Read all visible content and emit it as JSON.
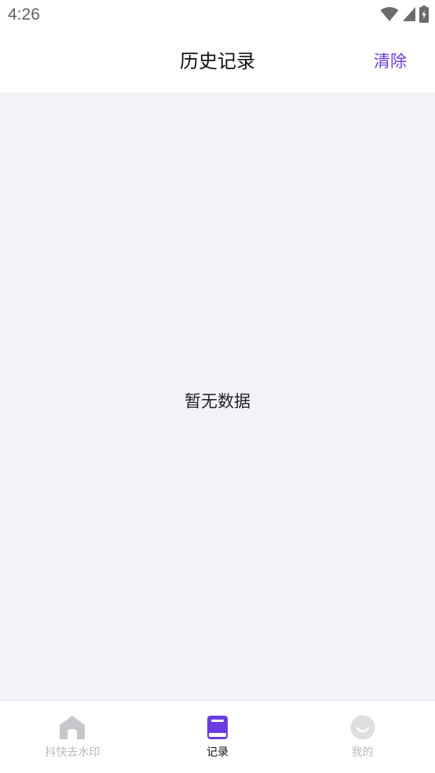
{
  "status_bar": {
    "time": "4:26"
  },
  "header": {
    "title": "历史记录",
    "clear_label": "清除"
  },
  "content": {
    "empty_text": "暂无数据"
  },
  "tabs": [
    {
      "label": "抖快去水印",
      "icon": "home-icon",
      "active": false
    },
    {
      "label": "记录",
      "icon": "book-icon",
      "active": true
    },
    {
      "label": "我的",
      "icon": "smile-icon",
      "active": false
    }
  ],
  "colors": {
    "accent": "#6a3bde",
    "content_bg": "#f3f2f9",
    "inactive": "#b9b9b9"
  }
}
